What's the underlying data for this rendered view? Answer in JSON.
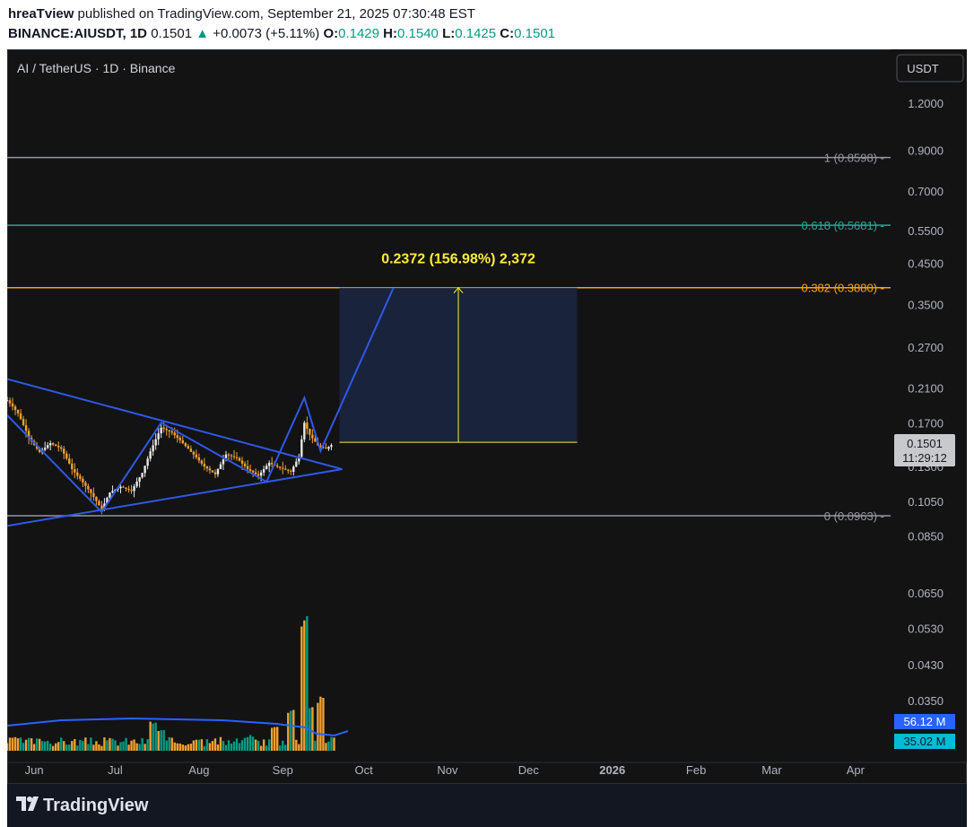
{
  "header": {
    "author": "hreaTview",
    "published_text": "published on TradingView.com, September 21, 2025 07:30:48 EST",
    "symbol": "BINANCE:AIUSDT, 1D",
    "last": "0.1501",
    "change": "+0.0073 (+5.11%)",
    "o_label": "O:",
    "o": "0.1429",
    "h_label": "H:",
    "h": "0.1540",
    "l_label": "L:",
    "l": "0.1425",
    "c_label": "C:",
    "c": "0.1501"
  },
  "chart_title": "AI / TetherUS · 1D · Binance",
  "currency_button": "USDT",
  "footer": {
    "brand": "TradingView"
  },
  "colors": {
    "up": "#089981",
    "down": "#f0a030",
    "drawing": "#2f59e8",
    "fib_1": "#9598a1",
    "fib_618": "#22ab94",
    "fib_382": "#f7a21b",
    "fib_0": "#9598a1",
    "measure": "#ffeb3b",
    "vol_ma": "#2962ff",
    "vol_badge": "#2962ff",
    "vol_badge2": "#00bcd4"
  },
  "chart_data": {
    "type": "candlestick",
    "y_scale": "log",
    "ylim": [
      0.072,
      1.28
    ],
    "x_start": "2025-05-22",
    "x_end": "2026-04-14",
    "y_ticks": [
      "1.2000",
      "0.9000",
      "0.7000",
      "0.5500",
      "0.4500",
      "0.3500",
      "0.2700",
      "0.2100",
      "0.1700",
      "0.1300",
      "0.1050",
      "0.0850",
      "0.0650",
      "0.0530",
      "0.0430",
      "0.0350"
    ],
    "x_ticks": [
      {
        "label": "Jun",
        "date": "2025-06-01"
      },
      {
        "label": "Jul",
        "date": "2025-07-01"
      },
      {
        "label": "Aug",
        "date": "2025-08-01"
      },
      {
        "label": "Sep",
        "date": "2025-09-01"
      },
      {
        "label": "Oct",
        "date": "2025-10-01"
      },
      {
        "label": "Nov",
        "date": "2025-11-01"
      },
      {
        "label": "Dec",
        "date": "2025-12-01"
      },
      {
        "label": "2026",
        "date": "2026-01-01"
      },
      {
        "label": "Feb",
        "date": "2026-02-01"
      },
      {
        "label": "Mar",
        "date": "2026-03-01"
      },
      {
        "label": "Apr",
        "date": "2026-04-01"
      }
    ],
    "closes": [
      {
        "date": "2025-05-22",
        "close": 0.195
      },
      {
        "date": "2025-05-26",
        "close": 0.18
      },
      {
        "date": "2025-05-30",
        "close": 0.155
      },
      {
        "date": "2025-06-03",
        "close": 0.142
      },
      {
        "date": "2025-06-07",
        "close": 0.15
      },
      {
        "date": "2025-06-11",
        "close": 0.145
      },
      {
        "date": "2025-06-15",
        "close": 0.128
      },
      {
        "date": "2025-06-19",
        "close": 0.118
      },
      {
        "date": "2025-06-23",
        "close": 0.108
      },
      {
        "date": "2025-06-26",
        "close": 0.1
      },
      {
        "date": "2025-06-29",
        "close": 0.111
      },
      {
        "date": "2025-07-03",
        "close": 0.115
      },
      {
        "date": "2025-07-07",
        "close": 0.112
      },
      {
        "date": "2025-07-11",
        "close": 0.125
      },
      {
        "date": "2025-07-15",
        "close": 0.148
      },
      {
        "date": "2025-07-18",
        "close": 0.165
      },
      {
        "date": "2025-07-22",
        "close": 0.16
      },
      {
        "date": "2025-07-26",
        "close": 0.15
      },
      {
        "date": "2025-07-30",
        "close": 0.14
      },
      {
        "date": "2025-08-03",
        "close": 0.13
      },
      {
        "date": "2025-08-07",
        "close": 0.124
      },
      {
        "date": "2025-08-11",
        "close": 0.14
      },
      {
        "date": "2025-08-15",
        "close": 0.137
      },
      {
        "date": "2025-08-19",
        "close": 0.128
      },
      {
        "date": "2025-08-23",
        "close": 0.123
      },
      {
        "date": "2025-08-27",
        "close": 0.133
      },
      {
        "date": "2025-08-31",
        "close": 0.129
      },
      {
        "date": "2025-09-04",
        "close": 0.126
      },
      {
        "date": "2025-09-07",
        "close": 0.138
      },
      {
        "date": "2025-09-09",
        "close": 0.17
      },
      {
        "date": "2025-09-11",
        "close": 0.158
      },
      {
        "date": "2025-09-14",
        "close": 0.148
      },
      {
        "date": "2025-09-17",
        "close": 0.145
      },
      {
        "date": "2025-09-20",
        "close": 0.1501
      }
    ],
    "volume_series": [
      {
        "date": "2025-05-25",
        "volume": 18
      },
      {
        "date": "2025-06-05",
        "volume": 14
      },
      {
        "date": "2025-06-24",
        "volume": 11
      },
      {
        "date": "2025-07-15",
        "volume": 40
      },
      {
        "date": "2025-07-18",
        "volume": 28
      },
      {
        "date": "2025-08-01",
        "volume": 17
      },
      {
        "date": "2025-08-20",
        "volume": 21
      },
      {
        "date": "2025-08-29",
        "volume": 33
      },
      {
        "date": "2025-09-04",
        "volume": 58
      },
      {
        "date": "2025-09-09",
        "volume": 190
      },
      {
        "date": "2025-09-11",
        "volume": 64
      },
      {
        "date": "2025-09-15",
        "volume": 72
      },
      {
        "date": "2025-09-20",
        "volume": 20
      }
    ],
    "volume_ma_label": "56.12 M",
    "volume_label": "35.02 M",
    "fib_levels": [
      {
        "label": "1 (0.8598)",
        "price": 0.8598,
        "color": "#9598a1"
      },
      {
        "label": "0.618 (0.5681)",
        "price": 0.5681,
        "color": "#22ab94"
      },
      {
        "label": "0.382 (0.3880)",
        "price": 0.388,
        "color": "#f7a21b"
      },
      {
        "label": "0 (0.0963)",
        "price": 0.0963,
        "color": "#9598a1"
      }
    ],
    "measure": {
      "label": "0.2372 (156.98%) 2,372",
      "date_start": "2025-09-22",
      "date_end": "2025-12-19",
      "price_low": 0.1508,
      "price_high": 0.388
    },
    "triangle_upper": [
      {
        "date": "2025-05-22",
        "price": 0.222
      },
      {
        "date": "2025-09-23",
        "price": 0.128
      }
    ],
    "triangle_lower": [
      {
        "date": "2025-05-22",
        "price": 0.0905
      },
      {
        "date": "2025-09-23",
        "price": 0.128
      }
    ],
    "zigzag": [
      {
        "date": "2025-05-22",
        "price": 0.178
      },
      {
        "date": "2025-06-26",
        "price": 0.0985
      },
      {
        "date": "2025-07-18",
        "price": 0.17
      },
      {
        "date": "2025-08-26",
        "price": 0.1185
      },
      {
        "date": "2025-09-09",
        "price": 0.198
      },
      {
        "date": "2025-09-15",
        "price": 0.143
      },
      {
        "date": "2025-10-12",
        "price": 0.388
      }
    ],
    "price_badge": {
      "value": "0.1501",
      "countdown": "11:29:12"
    }
  }
}
